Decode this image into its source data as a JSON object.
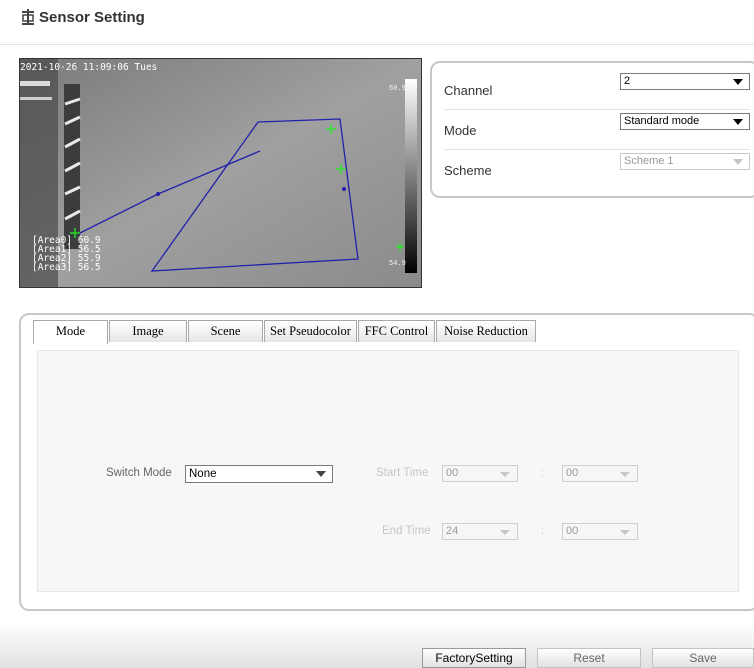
{
  "page": {
    "title": "Sensor Setting"
  },
  "video": {
    "timestamp": "2021-10-26 11:09:06 Tues",
    "temp_max": "60.9",
    "temp_min": "54.9",
    "areas": [
      "[Area0] 60.9",
      "[Area1] 56.5",
      "[Area2] 55.9",
      "[Area3] 56.5"
    ]
  },
  "settings": {
    "channel_label": "Channel",
    "channel_value": "2",
    "mode_label": "Mode",
    "mode_value": "Standard mode",
    "scheme_label": "Scheme",
    "scheme_value": "Scheme 1"
  },
  "tabs": [
    "Mode",
    "Image",
    "Scene",
    "Set Pseudocolor",
    "FFC Control",
    "Noise Reduction"
  ],
  "mode_tab": {
    "switch_mode_label": "Switch Mode",
    "switch_mode_value": "None",
    "start_time_label": "Start Time",
    "start_hour": "00",
    "start_minute": "00",
    "end_time_label": "End Time",
    "end_hour": "24",
    "end_minute": "00",
    "separator": ":"
  },
  "footer": {
    "factory_label": "FactorySetting",
    "reset_label": "Reset",
    "save_label": "Save"
  },
  "colors": {
    "polygon": "#2222aa",
    "marker": "#22ee22",
    "panel_border": "#c7c7c7"
  }
}
